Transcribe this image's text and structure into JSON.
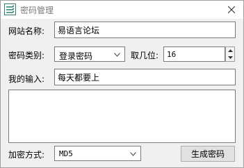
{
  "window": {
    "title": "密码管理",
    "app_icon": "app-logo-icon",
    "close_icon": "close-icon"
  },
  "form": {
    "site_label": "网站名称:",
    "site_value": "易语言论坛",
    "category_label": "密码类别:",
    "category_selected": "登录密码",
    "length_label": "取几位:",
    "length_value": "16",
    "input_label": "我的输入:",
    "input_value": "每天都要上",
    "output_value": "",
    "encrypt_label": "加密方式:",
    "encrypt_selected": "MD5",
    "generate_button": "生成密码"
  },
  "colors": {
    "title_text": "#7a7a7a",
    "window_bg": "#f0f0f0",
    "button_bg": "#e1e1e1"
  }
}
